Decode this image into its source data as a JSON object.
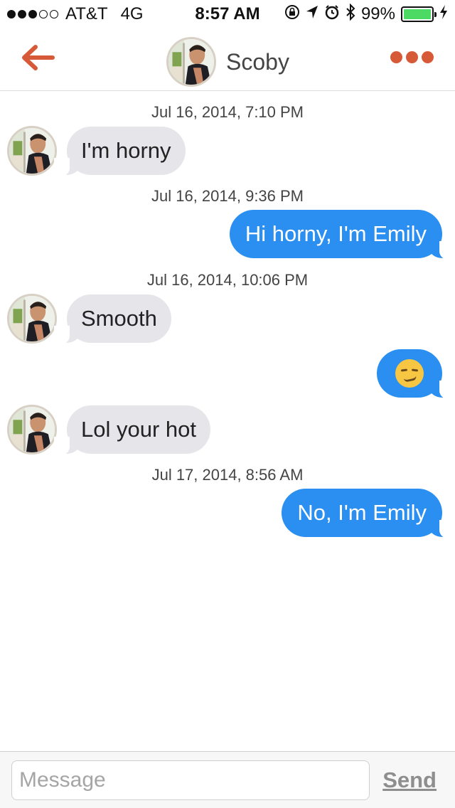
{
  "status_bar": {
    "carrier": "AT&T",
    "network": "4G",
    "time": "8:57 AM",
    "battery": "99%",
    "battery_level": 0.99,
    "signal_bars_filled": 3,
    "signal_bars_total": 5,
    "icons": [
      "orientation-lock-icon",
      "location-icon",
      "alarm-icon",
      "bluetooth-icon",
      "battery-icon",
      "charging-icon"
    ]
  },
  "header": {
    "title": "Scoby",
    "back_icon": "back-arrow-icon",
    "more_icon": "more-options-icon",
    "accent_color": "#d75a38"
  },
  "conversation": {
    "timestamps": [
      "Jul 16, 2014, 7:10 PM",
      "Jul 16, 2014, 9:36 PM",
      "Jul 16, 2014, 10:06 PM",
      "Jul 17, 2014, 8:56 AM"
    ],
    "messages": [
      {
        "from": "them",
        "text": "I'm horny"
      },
      {
        "from": "me",
        "text": "Hi horny, I'm Emily"
      },
      {
        "from": "them",
        "text": "Smooth"
      },
      {
        "from": "me",
        "text": "",
        "emoji": "smirking-face"
      },
      {
        "from": "them",
        "text": "Lol your hot"
      },
      {
        "from": "me",
        "text": "No, I'm Emily"
      }
    ],
    "incoming_bubble_color": "#e5e5ea",
    "outgoing_bubble_color": "#2a8ff0"
  },
  "composer": {
    "placeholder": "Message",
    "value": "",
    "send_label": "Send"
  }
}
